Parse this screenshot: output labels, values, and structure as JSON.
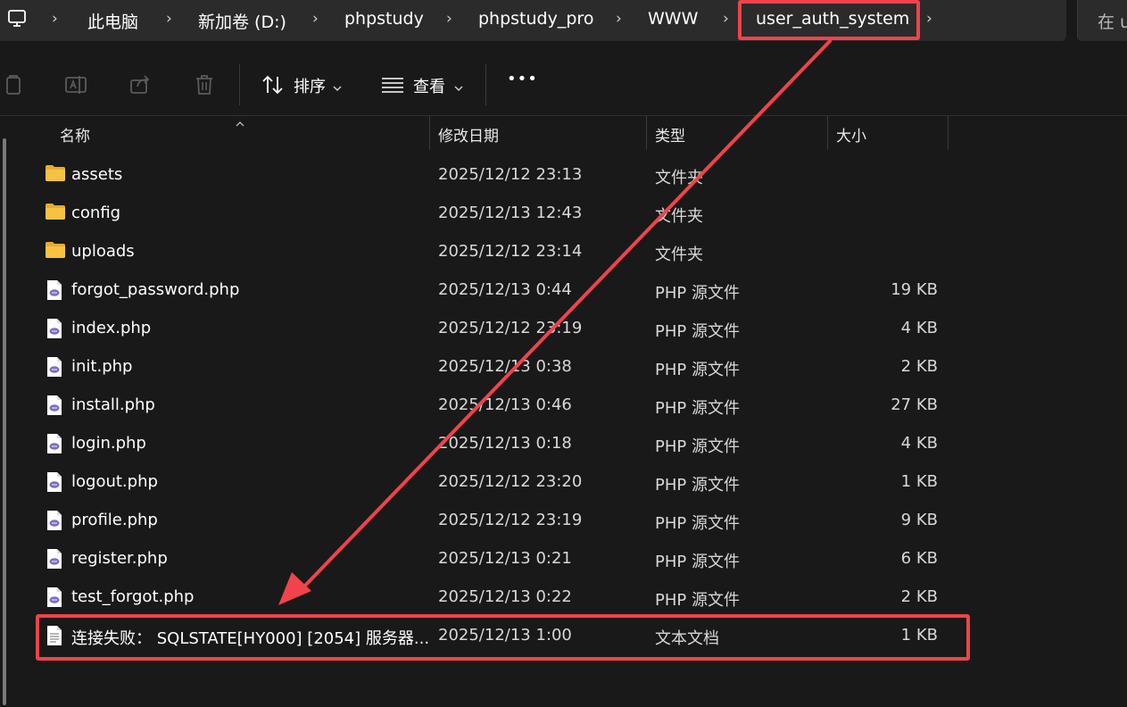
{
  "breadcrumb": {
    "items": [
      "此电脑",
      "新加卷 (D:)",
      "phpstudy",
      "phpstudy_pro",
      "WWW",
      "user_auth_system"
    ],
    "search_prefix": "在 u"
  },
  "toolbar": {
    "sort_label": "排序",
    "view_label": "查看",
    "more_label": "•••"
  },
  "columns": {
    "name": "名称",
    "modified": "修改日期",
    "type": "类型",
    "size": "大小"
  },
  "files": [
    {
      "name": "assets",
      "modified": "2025/12/12 23:13",
      "type": "文件夹",
      "size": "",
      "kind": "folder"
    },
    {
      "name": "config",
      "modified": "2025/12/13 12:43",
      "type": "文件夹",
      "size": "",
      "kind": "folder"
    },
    {
      "name": "uploads",
      "modified": "2025/12/12 23:14",
      "type": "文件夹",
      "size": "",
      "kind": "folder"
    },
    {
      "name": "forgot_password.php",
      "modified": "2025/12/13 0:44",
      "type": "PHP 源文件",
      "size": "19 KB",
      "kind": "php"
    },
    {
      "name": "index.php",
      "modified": "2025/12/12 23:19",
      "type": "PHP 源文件",
      "size": "4 KB",
      "kind": "php"
    },
    {
      "name": "init.php",
      "modified": "2025/12/13 0:38",
      "type": "PHP 源文件",
      "size": "2 KB",
      "kind": "php"
    },
    {
      "name": "install.php",
      "modified": "2025/12/13 0:46",
      "type": "PHP 源文件",
      "size": "27 KB",
      "kind": "php"
    },
    {
      "name": "login.php",
      "modified": "2025/12/13 0:18",
      "type": "PHP 源文件",
      "size": "4 KB",
      "kind": "php"
    },
    {
      "name": "logout.php",
      "modified": "2025/12/12 23:20",
      "type": "PHP 源文件",
      "size": "1 KB",
      "kind": "php"
    },
    {
      "name": "profile.php",
      "modified": "2025/12/12 23:19",
      "type": "PHP 源文件",
      "size": "9 KB",
      "kind": "php"
    },
    {
      "name": "register.php",
      "modified": "2025/12/13 0:21",
      "type": "PHP 源文件",
      "size": "6 KB",
      "kind": "php"
    },
    {
      "name": "test_forgot.php",
      "modified": "2025/12/13 0:22",
      "type": "PHP 源文件",
      "size": "2 KB",
      "kind": "php"
    },
    {
      "name": "连接失败： SQLSTATE[HY000] [2054] 服务器...",
      "modified": "2025/12/13 1:00",
      "type": "文本文档",
      "size": "1 KB",
      "kind": "txt"
    }
  ],
  "colors": {
    "annotation": "#f0434b",
    "folder": "#f6c244",
    "php_badge": "#7b6fc4"
  },
  "icons": [
    "computer-icon",
    "chevron-right-icon",
    "copy-icon",
    "rename-icon",
    "share-icon",
    "trash-icon",
    "sort-icon",
    "view-icon",
    "more-icon",
    "folder-icon",
    "php-file-icon",
    "text-file-icon"
  ]
}
